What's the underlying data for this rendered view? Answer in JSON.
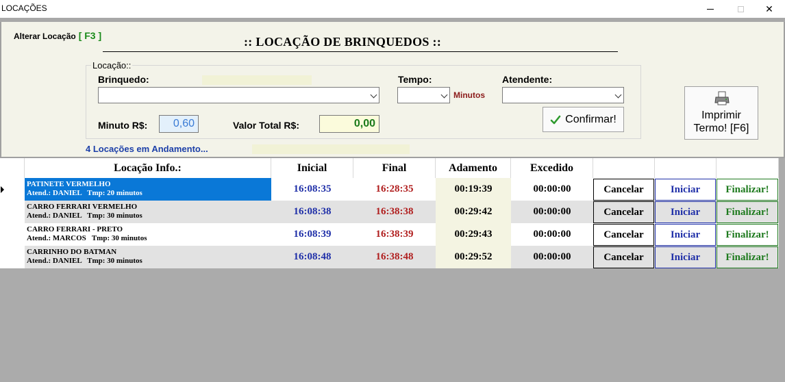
{
  "window": {
    "title": "LOCAÇÕES"
  },
  "header": {
    "alterar_label": "Alterar Locação",
    "alterar_key": "[ F3 ]",
    "title": ":: LOCAÇÃO DE BRINQUEDOS ::"
  },
  "form": {
    "group_label": "Locação::",
    "brinquedo_label": "Brinquedo:",
    "brinquedo_value": "",
    "tempo_label": "Tempo:",
    "tempo_value": "",
    "tempo_unit": "Minutos",
    "atendente_label": "Atendente:",
    "atendente_value": "",
    "minuto_label": "Minuto R$:",
    "minuto_value": "0,60",
    "valor_total_label": "Valor Total R$:",
    "valor_total_value": "0,00",
    "confirm_label": "Confirmar!",
    "print_label_line1": "Imprimir",
    "print_label_line2": "Termo!  [F6]",
    "status": "4 Locações em Andamento..."
  },
  "grid": {
    "columns": {
      "info": "Locação Info.:",
      "inicial": "Inicial",
      "final": "Final",
      "andamento": "Adamento",
      "excedido": "Excedido"
    },
    "rows": [
      {
        "toy": "PATINETE VERMELHO",
        "details": "Atend.: DANIEL   Tmp: 20 minutos",
        "inicial": "16:08:35",
        "final": "16:28:35",
        "andamento": "00:19:39",
        "excedido": "00:00:00",
        "cancel": "Cancelar",
        "iniciar": "Iniciar",
        "finalizar": "Finalizar!"
      },
      {
        "toy": "CARRO FERRARI VERMELHO",
        "details": "Atend.: DANIEL   Tmp: 30 minutos",
        "inicial": "16:08:38",
        "final": "16:38:38",
        "andamento": "00:29:42",
        "excedido": "00:00:00",
        "cancel": "Cancelar",
        "iniciar": "Iniciar",
        "finalizar": "Finalizar!"
      },
      {
        "toy": "CARRO FERRARI - PRETO",
        "details": "Atend.: MARCOS   Tmp: 30 minutos",
        "inicial": "16:08:39",
        "final": "16:38:39",
        "andamento": "00:29:43",
        "excedido": "00:00:00",
        "cancel": "Cancelar",
        "iniciar": "Iniciar",
        "finalizar": "Finalizar!"
      },
      {
        "toy": "CARRINHO DO BATMAN",
        "details": "Atend.: DANIEL   Tmp: 30 minutos",
        "inicial": "16:08:48",
        "final": "16:38:48",
        "andamento": "00:29:52",
        "excedido": "00:00:00",
        "cancel": "Cancelar",
        "iniciar": "Iniciar",
        "finalizar": "Finalizar!"
      }
    ]
  },
  "colors": {
    "selection": "#0a78d7",
    "inicial_text": "#1f2fa8",
    "final_text": "#b01e1e",
    "finalizar": "#1e7a1e"
  },
  "icons": {
    "confirm": "check-icon",
    "print": "printer-icon",
    "row_indicator": "row-pointer-icon"
  }
}
